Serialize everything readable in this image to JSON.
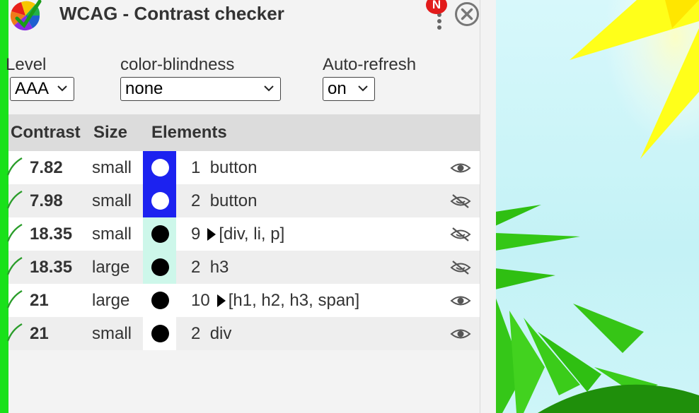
{
  "app": {
    "title": "WCAG - Contrast checker",
    "badge": "N"
  },
  "controls": {
    "level": {
      "label": "Level",
      "value": "AAA"
    },
    "color_blindness": {
      "label": "color-blindness",
      "value": "none"
    },
    "auto_refresh": {
      "label": "Auto-refresh",
      "value": "on"
    }
  },
  "table": {
    "headers": [
      "Contrast",
      "Size",
      "Elements"
    ],
    "rows": [
      {
        "ratio": "7.82",
        "size": "small",
        "swatch_bg": "#1c22f0",
        "dot_color": "#ffffff",
        "count": "1",
        "expandable": false,
        "elements": "button",
        "visible": true
      },
      {
        "ratio": "7.98",
        "size": "small",
        "swatch_bg": "#1c22f0",
        "dot_color": "#ffffff",
        "count": "2",
        "expandable": false,
        "elements": "button",
        "visible": false
      },
      {
        "ratio": "18.35",
        "size": "small",
        "swatch_bg": "#cdf7ea",
        "dot_color": "#000000",
        "count": "9",
        "expandable": true,
        "elements": "[div, li, p]",
        "visible": false
      },
      {
        "ratio": "18.35",
        "size": "large",
        "swatch_bg": "#cdf7ea",
        "dot_color": "#000000",
        "count": "2",
        "expandable": false,
        "elements": "h3",
        "visible": false
      },
      {
        "ratio": "21",
        "size": "large",
        "swatch_bg": "#ffffff",
        "dot_color": "#000000",
        "count": "10",
        "expandable": true,
        "elements": "[h1, h2, h3, span]",
        "visible": true
      },
      {
        "ratio": "21",
        "size": "small",
        "swatch_bg": "#ffffff",
        "dot_color": "#000000",
        "count": "2",
        "expandable": false,
        "elements": "div",
        "visible": true
      }
    ]
  },
  "colors": {
    "accent_green": "#19e11a",
    "badge_red": "#e21b1b",
    "check_green": "#2a9d2a"
  }
}
